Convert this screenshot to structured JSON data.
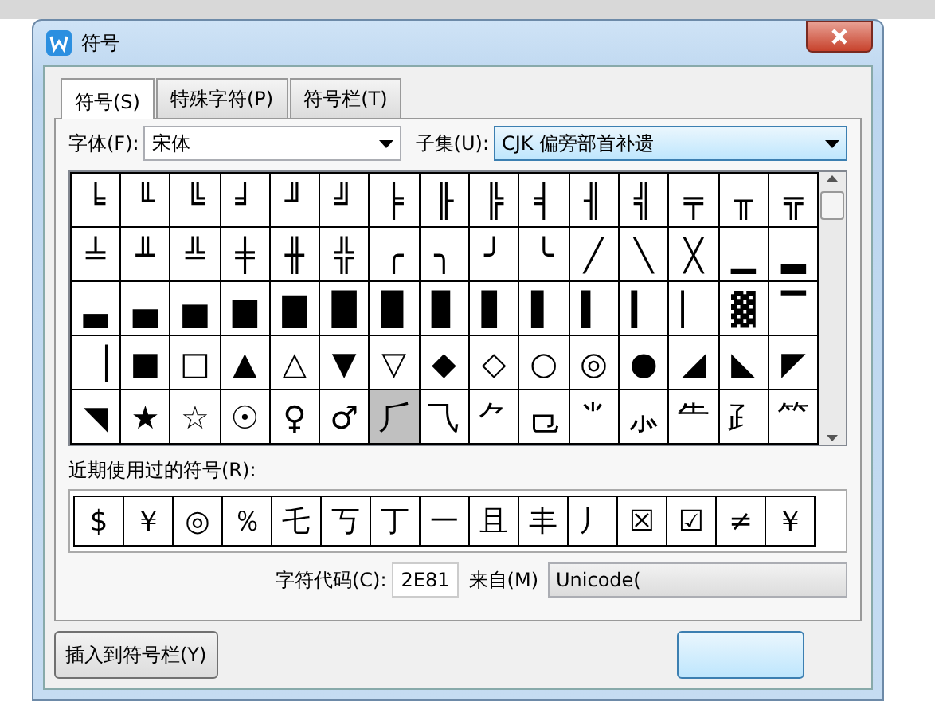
{
  "window": {
    "title": "符号"
  },
  "tabs": [
    {
      "label": "符号(S)",
      "selected": true
    },
    {
      "label": "特殊字符(P)",
      "selected": false
    },
    {
      "label": "符号栏(T)",
      "selected": false
    }
  ],
  "font": {
    "label": "字体(F):",
    "value": "宋体"
  },
  "subset": {
    "label": "子集(U):",
    "value": "CJK 偏旁部首补遗"
  },
  "grid": {
    "rows": [
      [
        {
          "c": "╘",
          "selected": false
        },
        {
          "c": "╙",
          "selected": false
        },
        {
          "c": "╚",
          "selected": false
        },
        {
          "c": "╛",
          "selected": false
        },
        {
          "c": "╜",
          "selected": false
        },
        {
          "c": "╝",
          "selected": false
        },
        {
          "c": "╞",
          "selected": false
        },
        {
          "c": "╟",
          "selected": false
        },
        {
          "c": "╠",
          "selected": false
        },
        {
          "c": "╡",
          "selected": false
        },
        {
          "c": "╢",
          "selected": false
        },
        {
          "c": "╣",
          "selected": false
        },
        {
          "c": "╤",
          "selected": false
        },
        {
          "c": "╥",
          "selected": false
        },
        {
          "c": "╦",
          "selected": false
        }
      ],
      [
        {
          "c": "╧",
          "selected": false
        },
        {
          "c": "╨",
          "selected": false
        },
        {
          "c": "╩",
          "selected": false
        },
        {
          "c": "╪",
          "selected": false
        },
        {
          "c": "╫",
          "selected": false
        },
        {
          "c": "╬",
          "selected": false
        },
        {
          "c": "╭",
          "selected": false
        },
        {
          "c": "╮",
          "selected": false
        },
        {
          "c": "╯",
          "selected": false
        },
        {
          "c": "╰",
          "selected": false
        },
        {
          "c": "╱",
          "selected": false
        },
        {
          "c": "╲",
          "selected": false
        },
        {
          "c": "╳",
          "selected": false
        },
        {
          "c": "▁",
          "selected": false
        },
        {
          "c": "▂",
          "selected": false
        }
      ],
      [
        {
          "c": "▃",
          "selected": false
        },
        {
          "c": "▄",
          "selected": false
        },
        {
          "c": "▅",
          "selected": false
        },
        {
          "c": "▆",
          "selected": false
        },
        {
          "c": "▇",
          "selected": false
        },
        {
          "c": "█",
          "selected": false
        },
        {
          "c": "▉",
          "selected": false
        },
        {
          "c": "▊",
          "selected": false
        },
        {
          "c": "▋",
          "selected": false
        },
        {
          "c": "▌",
          "selected": false
        },
        {
          "c": "▍",
          "selected": false
        },
        {
          "c": "▎",
          "selected": false
        },
        {
          "c": "▏",
          "selected": false
        },
        {
          "c": "▓",
          "selected": false
        },
        {
          "c": "▔",
          "selected": false
        }
      ],
      [
        {
          "c": "▕",
          "selected": false
        },
        {
          "c": "■",
          "selected": false
        },
        {
          "c": "□",
          "selected": false
        },
        {
          "c": "▲",
          "selected": false
        },
        {
          "c": "△",
          "selected": false
        },
        {
          "c": "▼",
          "selected": false
        },
        {
          "c": "▽",
          "selected": false
        },
        {
          "c": "◆",
          "selected": false
        },
        {
          "c": "◇",
          "selected": false
        },
        {
          "c": "○",
          "selected": false
        },
        {
          "c": "◎",
          "selected": false
        },
        {
          "c": "●",
          "selected": false
        },
        {
          "c": "◢",
          "selected": false
        },
        {
          "c": "◣",
          "selected": false
        },
        {
          "c": "◤",
          "selected": false
        }
      ],
      [
        {
          "c": "◥",
          "selected": false
        },
        {
          "c": "★",
          "selected": false
        },
        {
          "c": "☆",
          "selected": false
        },
        {
          "c": "☉",
          "selected": false
        },
        {
          "c": "♀",
          "selected": false
        },
        {
          "c": "♂",
          "selected": false
        },
        {
          "c": "⺁",
          "selected": true
        },
        {
          "c": "⺄",
          "selected": false
        },
        {
          "c": "⺈",
          "selected": false
        },
        {
          "c": "⺋",
          "selected": false
        },
        {
          "c": "⺌",
          "selected": false
        },
        {
          "c": "⺗",
          "selected": false
        },
        {
          "c": "⺧",
          "selected": false
        },
        {
          "c": "⺪",
          "selected": false
        },
        {
          "c": "⺮",
          "selected": false
        }
      ]
    ]
  },
  "recent": {
    "label": "近期使用过的符号(R):",
    "symbols": [
      "$",
      "￥",
      "◎",
      "％",
      "乇",
      "丂",
      "丁",
      "一",
      "且",
      "丰",
      "丿",
      "☒",
      "☑",
      "≠",
      "￥"
    ]
  },
  "code": {
    "label": "字符代码(C):",
    "value": "2E81"
  },
  "source": {
    "label": "来自(M)",
    "value": "Unicode("
  },
  "buttons": [
    {
      "kind": "plain",
      "label": "插入到符号栏(Y)"
    },
    {
      "kind": "default"
    }
  ]
}
